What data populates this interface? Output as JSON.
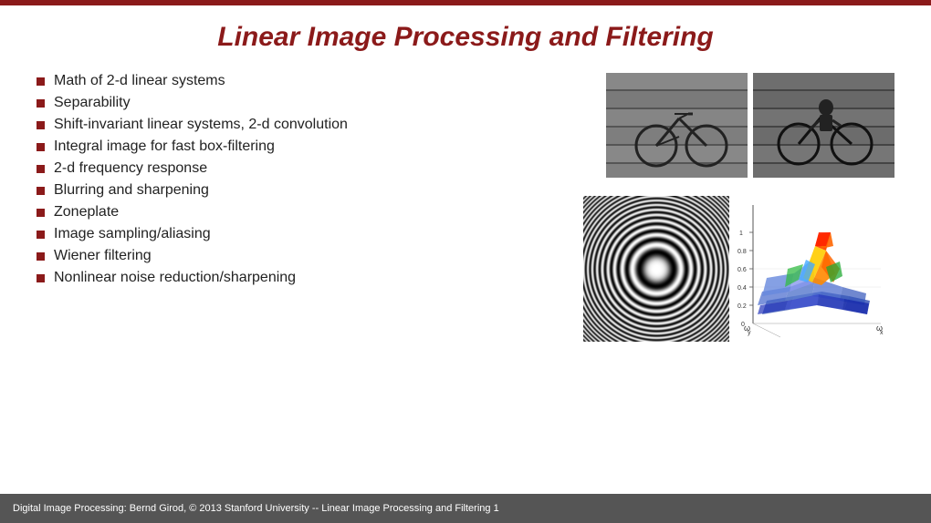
{
  "topbar": {},
  "header": {
    "title": "Linear Image Processing and Filtering"
  },
  "bullets": [
    "Math of 2-d linear systems",
    "Separability",
    "Shift-invariant linear systems, 2-d convolution",
    "Integral image for fast box-filtering",
    "2-d frequency response",
    "Blurring and sharpening",
    "Zoneplate",
    "Image sampling/aliasing",
    "Wiener filtering",
    "Nonlinear noise reduction/sharpening"
  ],
  "footer": {
    "text": "Digital Image Processing: Bernd Girod, © 2013 Stanford University  -- Linear Image Processing and Filtering 1"
  }
}
